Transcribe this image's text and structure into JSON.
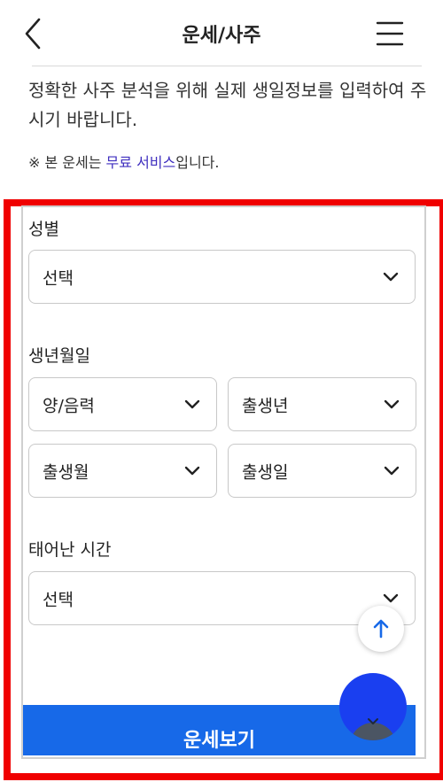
{
  "header": {
    "title": "운세/사주"
  },
  "intro": {
    "text": "정확한 사주 분석을 위해 실제 생일정보를 입력하여 주시기 바랍니다.",
    "notice_prefix": "※ 본 운세는 ",
    "notice_accent": "무료 서비스",
    "notice_suffix": "입니다."
  },
  "form": {
    "gender": {
      "label": "성별",
      "value": "선택"
    },
    "birthdate": {
      "label": "생년월일",
      "calendar_type": "양/음력",
      "year": "출생년",
      "month": "출생월",
      "day": "출생일"
    },
    "birth_time": {
      "label": "태어난 시간",
      "value": "선택"
    },
    "submit_label": "운세보기"
  },
  "colors": {
    "accent_text": "#3f2fbf",
    "highlight_frame": "#f00000",
    "submit_button": "#1769e8",
    "floating_button": "#1a3ff0",
    "scroll_top_arrow": "#1769e8"
  },
  "icons": {
    "back": "chevron-left-icon",
    "menu": "hamburger-menu-icon",
    "dropdown": "chevron-down-icon",
    "scroll_top": "arrow-up-icon"
  }
}
